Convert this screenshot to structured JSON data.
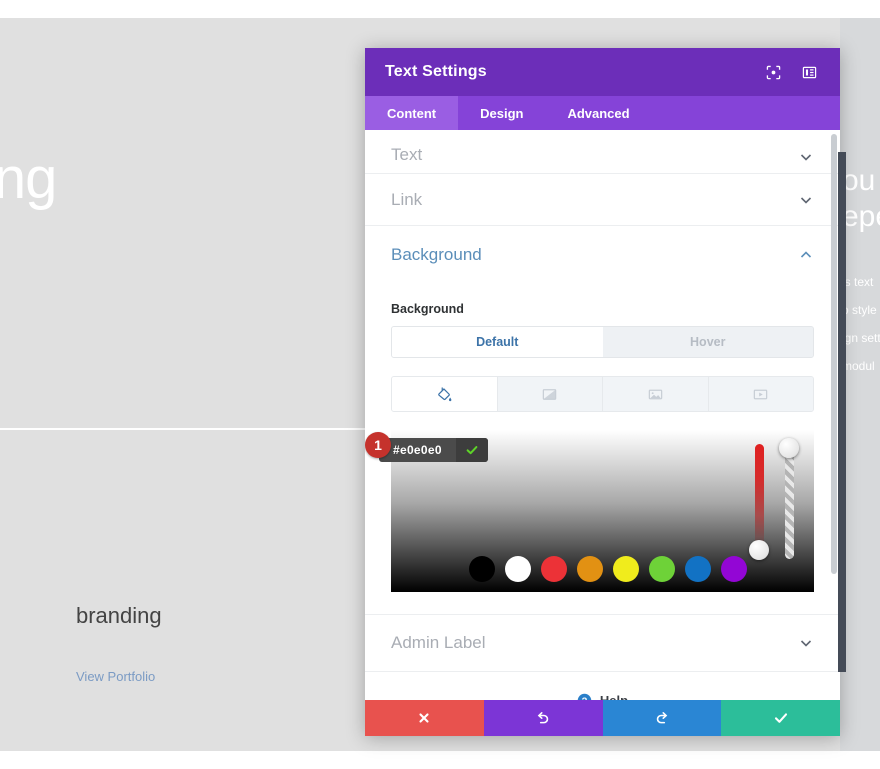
{
  "page": {
    "hero_word": "ing",
    "branding_heading": "branding",
    "portfolio_link": "View Portfolio",
    "right_column": {
      "heading_line1": "ou c",
      "heading_line2": "epe",
      "body_line1": "is text",
      "body_line2": "o style",
      "body_line3": "ign sett",
      "body_line4": "modul"
    },
    "background_color": "#e0e0e0",
    "divider_color": "#ffffff"
  },
  "modal": {
    "title": "Text Settings",
    "header_icons": [
      {
        "name": "focus-target-icon",
        "label": "Focus"
      },
      {
        "name": "layout-panel-icon",
        "label": "Layout"
      }
    ],
    "header_color": "#6c2eb9",
    "tabs_color": "#8543d8",
    "tabs": [
      {
        "label": "Content",
        "active": true
      },
      {
        "label": "Design",
        "active": false
      },
      {
        "label": "Advanced",
        "active": false
      }
    ],
    "sections": [
      {
        "label": "Text",
        "open": false
      },
      {
        "label": "Link",
        "open": false
      },
      {
        "label": "Background",
        "open": true
      },
      {
        "label": "Admin Label",
        "open": false
      }
    ],
    "background_section": {
      "field_label": "Background",
      "state_tabs": [
        {
          "label": "Default",
          "active": true
        },
        {
          "label": "Hover",
          "active": false
        }
      ],
      "type_buttons": [
        {
          "name": "paint-bucket-icon",
          "label": "Color",
          "active": true
        },
        {
          "name": "gradient-icon",
          "label": "Gradient",
          "active": false
        },
        {
          "name": "image-icon",
          "label": "Image",
          "active": false
        },
        {
          "name": "video-icon",
          "label": "Video",
          "active": false
        }
      ],
      "color_picker": {
        "hex_value": "#e0e0e0",
        "step_badge": "1",
        "submit_icon": "check-icon",
        "hue_value": 0,
        "alpha_value": 100,
        "swatches": [
          {
            "name": "swatch-black",
            "color": "#000000"
          },
          {
            "name": "swatch-white",
            "color": "#ffffff"
          },
          {
            "name": "swatch-red",
            "color": "#ec3237"
          },
          {
            "name": "swatch-orange",
            "color": "#e29113"
          },
          {
            "name": "swatch-yellow",
            "color": "#f0ec1c"
          },
          {
            "name": "swatch-green",
            "color": "#6ed238"
          },
          {
            "name": "swatch-blue",
            "color": "#1272c4"
          },
          {
            "name": "swatch-purple",
            "color": "#9306d5"
          }
        ]
      }
    },
    "help": {
      "label": "Help",
      "icon": "question-circle-icon"
    },
    "footer_buttons": [
      {
        "name": "cancel-button",
        "icon": "close-icon",
        "color": "#e8524e"
      },
      {
        "name": "undo-button",
        "icon": "undo-icon",
        "color": "#7c35d6"
      },
      {
        "name": "redo-button",
        "icon": "redo-icon",
        "color": "#2a86d4"
      },
      {
        "name": "save-button",
        "icon": "check-icon",
        "color": "#2cbe9a"
      }
    ]
  }
}
